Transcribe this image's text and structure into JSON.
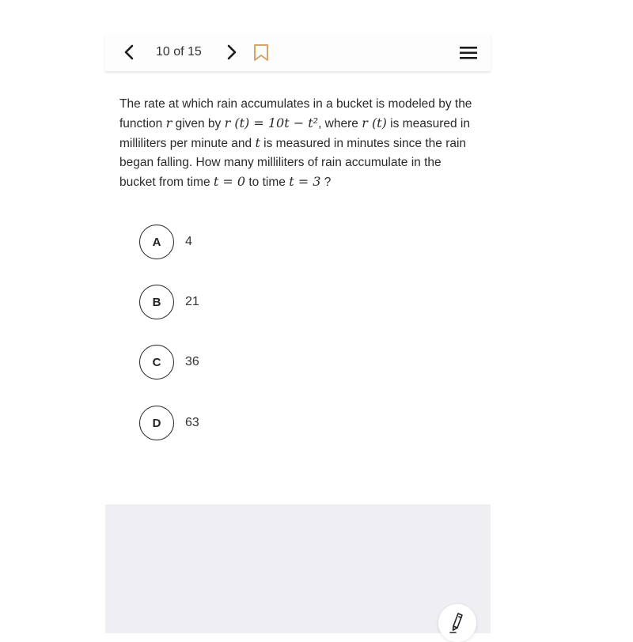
{
  "header": {
    "counter": "10 of 15",
    "prev_icon": "chevron-left-icon",
    "next_icon": "chevron-right-icon",
    "bookmark_icon": "bookmark-icon",
    "menu_icon": "hamburger-menu-icon",
    "bookmark_color": "#d4a468"
  },
  "question": {
    "p1": "The rate at which rain accumulates in a bucket is modeled by the function ",
    "m1": "r",
    "p2": " given by ",
    "m2": "r (t) = 10t − t²",
    "p3": ", where ",
    "m3": "r (t)",
    "p4": " is measured in milliliters per minute and ",
    "m4": "t",
    "p5": " is measured in minutes since the rain began falling. How many milliliters of rain accumulate in the bucket from time ",
    "m5": "t = 0",
    "p6": " to time ",
    "m6": "t = 3",
    "p7": " ?"
  },
  "choices": [
    {
      "letter": "A",
      "text": "4"
    },
    {
      "letter": "B",
      "text": "21"
    },
    {
      "letter": "C",
      "text": "36"
    },
    {
      "letter": "D",
      "text": "63"
    }
  ],
  "tools": {
    "highlighter_icon": "highlighter-pen-icon"
  }
}
